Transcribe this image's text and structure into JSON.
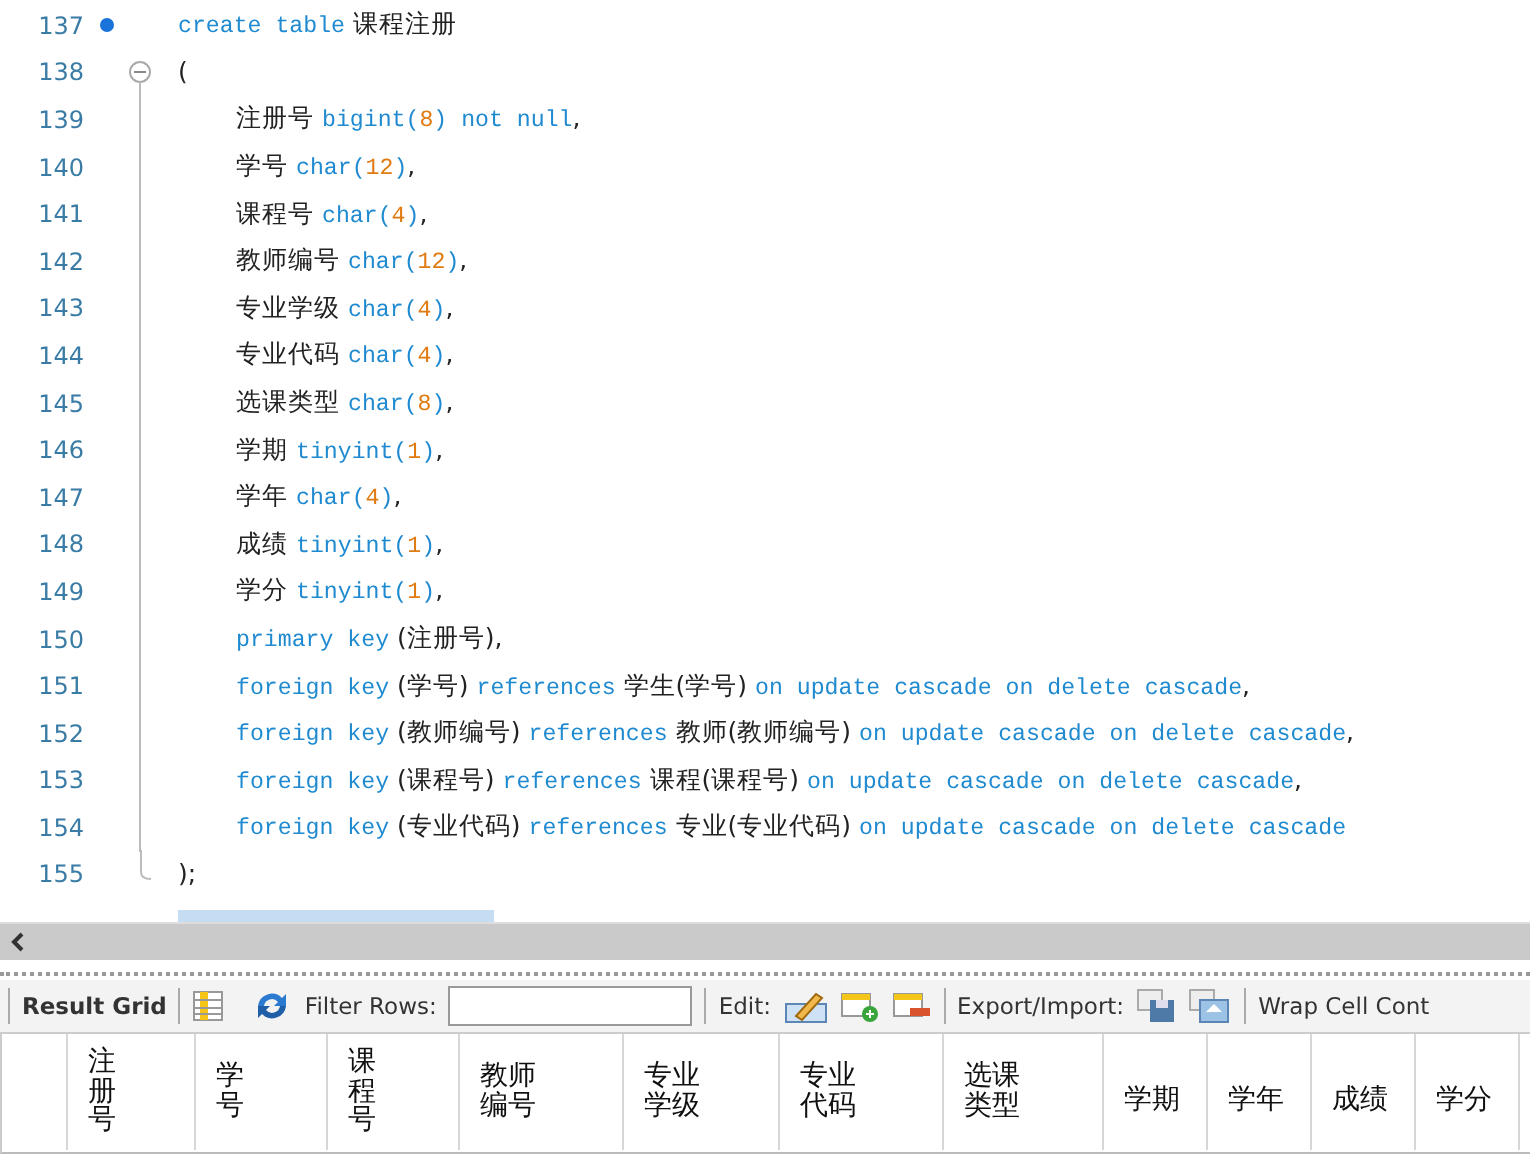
{
  "editor": {
    "lines": [
      {
        "number": "137",
        "breakpoint": true,
        "kind": "header",
        "tokens": [
          {
            "kind": "kw",
            "text": "create table"
          },
          {
            "kind": "plain",
            "text": " 课程注册"
          }
        ]
      },
      {
        "number": "138",
        "breakpoint": false,
        "kind": "open",
        "tokens": [
          {
            "kind": "plain",
            "text": "("
          }
        ]
      },
      {
        "number": "139",
        "breakpoint": false,
        "kind": "body",
        "tokens": [
          {
            "kind": "plain",
            "text": "注册号 "
          },
          {
            "kind": "kw",
            "text": "bigint("
          },
          {
            "kind": "num",
            "text": "8"
          },
          {
            "kind": "kw",
            "text": ") not null"
          },
          {
            "kind": "plain",
            "text": ","
          }
        ]
      },
      {
        "number": "140",
        "breakpoint": false,
        "kind": "body",
        "tokens": [
          {
            "kind": "plain",
            "text": "学号 "
          },
          {
            "kind": "kw",
            "text": "char("
          },
          {
            "kind": "num",
            "text": "12"
          },
          {
            "kind": "kw",
            "text": ")"
          },
          {
            "kind": "plain",
            "text": ","
          }
        ]
      },
      {
        "number": "141",
        "breakpoint": false,
        "kind": "body",
        "tokens": [
          {
            "kind": "plain",
            "text": "课程号 "
          },
          {
            "kind": "kw",
            "text": "char("
          },
          {
            "kind": "num",
            "text": "4"
          },
          {
            "kind": "kw",
            "text": ")"
          },
          {
            "kind": "plain",
            "text": ","
          }
        ]
      },
      {
        "number": "142",
        "breakpoint": false,
        "kind": "body",
        "tokens": [
          {
            "kind": "plain",
            "text": "教师编号 "
          },
          {
            "kind": "kw",
            "text": "char("
          },
          {
            "kind": "num",
            "text": "12"
          },
          {
            "kind": "kw",
            "text": ")"
          },
          {
            "kind": "plain",
            "text": ","
          }
        ]
      },
      {
        "number": "143",
        "breakpoint": false,
        "kind": "body",
        "tokens": [
          {
            "kind": "plain",
            "text": "专业学级 "
          },
          {
            "kind": "kw",
            "text": "char("
          },
          {
            "kind": "num",
            "text": "4"
          },
          {
            "kind": "kw",
            "text": ")"
          },
          {
            "kind": "plain",
            "text": ","
          }
        ]
      },
      {
        "number": "144",
        "breakpoint": false,
        "kind": "body",
        "tokens": [
          {
            "kind": "plain",
            "text": "专业代码 "
          },
          {
            "kind": "kw",
            "text": "char("
          },
          {
            "kind": "num",
            "text": "4"
          },
          {
            "kind": "kw",
            "text": ")"
          },
          {
            "kind": "plain",
            "text": ","
          }
        ]
      },
      {
        "number": "145",
        "breakpoint": false,
        "kind": "body",
        "tokens": [
          {
            "kind": "plain",
            "text": "选课类型 "
          },
          {
            "kind": "kw",
            "text": "char("
          },
          {
            "kind": "num",
            "text": "8"
          },
          {
            "kind": "kw",
            "text": ")"
          },
          {
            "kind": "plain",
            "text": ","
          }
        ]
      },
      {
        "number": "146",
        "breakpoint": false,
        "kind": "body",
        "tokens": [
          {
            "kind": "plain",
            "text": "学期 "
          },
          {
            "kind": "kw",
            "text": "tinyint("
          },
          {
            "kind": "num",
            "text": "1"
          },
          {
            "kind": "kw",
            "text": ")"
          },
          {
            "kind": "plain",
            "text": ","
          }
        ]
      },
      {
        "number": "147",
        "breakpoint": false,
        "kind": "body",
        "tokens": [
          {
            "kind": "plain",
            "text": "学年 "
          },
          {
            "kind": "kw",
            "text": "char("
          },
          {
            "kind": "num",
            "text": "4"
          },
          {
            "kind": "kw",
            "text": ")"
          },
          {
            "kind": "plain",
            "text": ","
          }
        ]
      },
      {
        "number": "148",
        "breakpoint": false,
        "kind": "body",
        "tokens": [
          {
            "kind": "plain",
            "text": "成绩 "
          },
          {
            "kind": "kw",
            "text": "tinyint("
          },
          {
            "kind": "num",
            "text": "1"
          },
          {
            "kind": "kw",
            "text": ")"
          },
          {
            "kind": "plain",
            "text": ","
          }
        ]
      },
      {
        "number": "149",
        "breakpoint": false,
        "kind": "body",
        "tokens": [
          {
            "kind": "plain",
            "text": "学分 "
          },
          {
            "kind": "kw",
            "text": "tinyint("
          },
          {
            "kind": "num",
            "text": "1"
          },
          {
            "kind": "kw",
            "text": ")"
          },
          {
            "kind": "plain",
            "text": ","
          }
        ]
      },
      {
        "number": "150",
        "breakpoint": false,
        "kind": "body",
        "tokens": [
          {
            "kind": "kw",
            "text": "primary key"
          },
          {
            "kind": "plain",
            "text": " (注册号),"
          }
        ]
      },
      {
        "number": "151",
        "breakpoint": false,
        "kind": "body",
        "tokens": [
          {
            "kind": "kw",
            "text": "foreign key"
          },
          {
            "kind": "plain",
            "text": " (学号) "
          },
          {
            "kind": "kw",
            "text": "references"
          },
          {
            "kind": "plain",
            "text": " 学生(学号) "
          },
          {
            "kind": "kw",
            "text": "on update cascade on delete cascade"
          },
          {
            "kind": "plain",
            "text": ","
          }
        ]
      },
      {
        "number": "152",
        "breakpoint": false,
        "kind": "body",
        "tokens": [
          {
            "kind": "kw",
            "text": "foreign key"
          },
          {
            "kind": "plain",
            "text": " (教师编号) "
          },
          {
            "kind": "kw",
            "text": "references"
          },
          {
            "kind": "plain",
            "text": " 教师(教师编号) "
          },
          {
            "kind": "kw",
            "text": "on update cascade on delete cascade"
          },
          {
            "kind": "plain",
            "text": ","
          }
        ]
      },
      {
        "number": "153",
        "breakpoint": false,
        "kind": "body",
        "tokens": [
          {
            "kind": "kw",
            "text": "foreign key"
          },
          {
            "kind": "plain",
            "text": " (课程号) "
          },
          {
            "kind": "kw",
            "text": "references"
          },
          {
            "kind": "plain",
            "text": " 课程(课程号) "
          },
          {
            "kind": "kw",
            "text": "on update cascade on delete cascade"
          },
          {
            "kind": "plain",
            "text": ","
          }
        ]
      },
      {
        "number": "154",
        "breakpoint": false,
        "kind": "body",
        "tokens": [
          {
            "kind": "kw",
            "text": "foreign key"
          },
          {
            "kind": "plain",
            "text": " (专业代码) "
          },
          {
            "kind": "kw",
            "text": "references"
          },
          {
            "kind": "plain",
            "text": " 专业(专业代码) "
          },
          {
            "kind": "kw",
            "text": "on update cascade on delete cascade"
          }
        ]
      },
      {
        "number": "155",
        "breakpoint": false,
        "kind": "close",
        "tokens": [
          {
            "kind": "plain",
            "text": ");"
          }
        ]
      }
    ]
  },
  "toolbar": {
    "result_grid": "Result Grid",
    "filter_label": "Filter Rows:",
    "edit_label": "Edit:",
    "export_label": "Export/Import:",
    "wrap_label": "Wrap Cell Cont"
  },
  "grid": {
    "columns": [
      {
        "label": "注册号",
        "kind": "stack1"
      },
      {
        "label": "学号",
        "kind": "stack1"
      },
      {
        "label": "课程号",
        "kind": "stack1"
      },
      {
        "label": "教师编号",
        "kind": "stack2"
      },
      {
        "label": "专业学级",
        "kind": "stack2"
      },
      {
        "label": "专业代码",
        "kind": "stack2"
      },
      {
        "label": "选课类型",
        "kind": "stack2"
      },
      {
        "label": "学期",
        "kind": "flat"
      },
      {
        "label": "学年",
        "kind": "flat"
      },
      {
        "label": "成绩",
        "kind": "flat"
      },
      {
        "label": "学分",
        "kind": "flat"
      }
    ]
  }
}
